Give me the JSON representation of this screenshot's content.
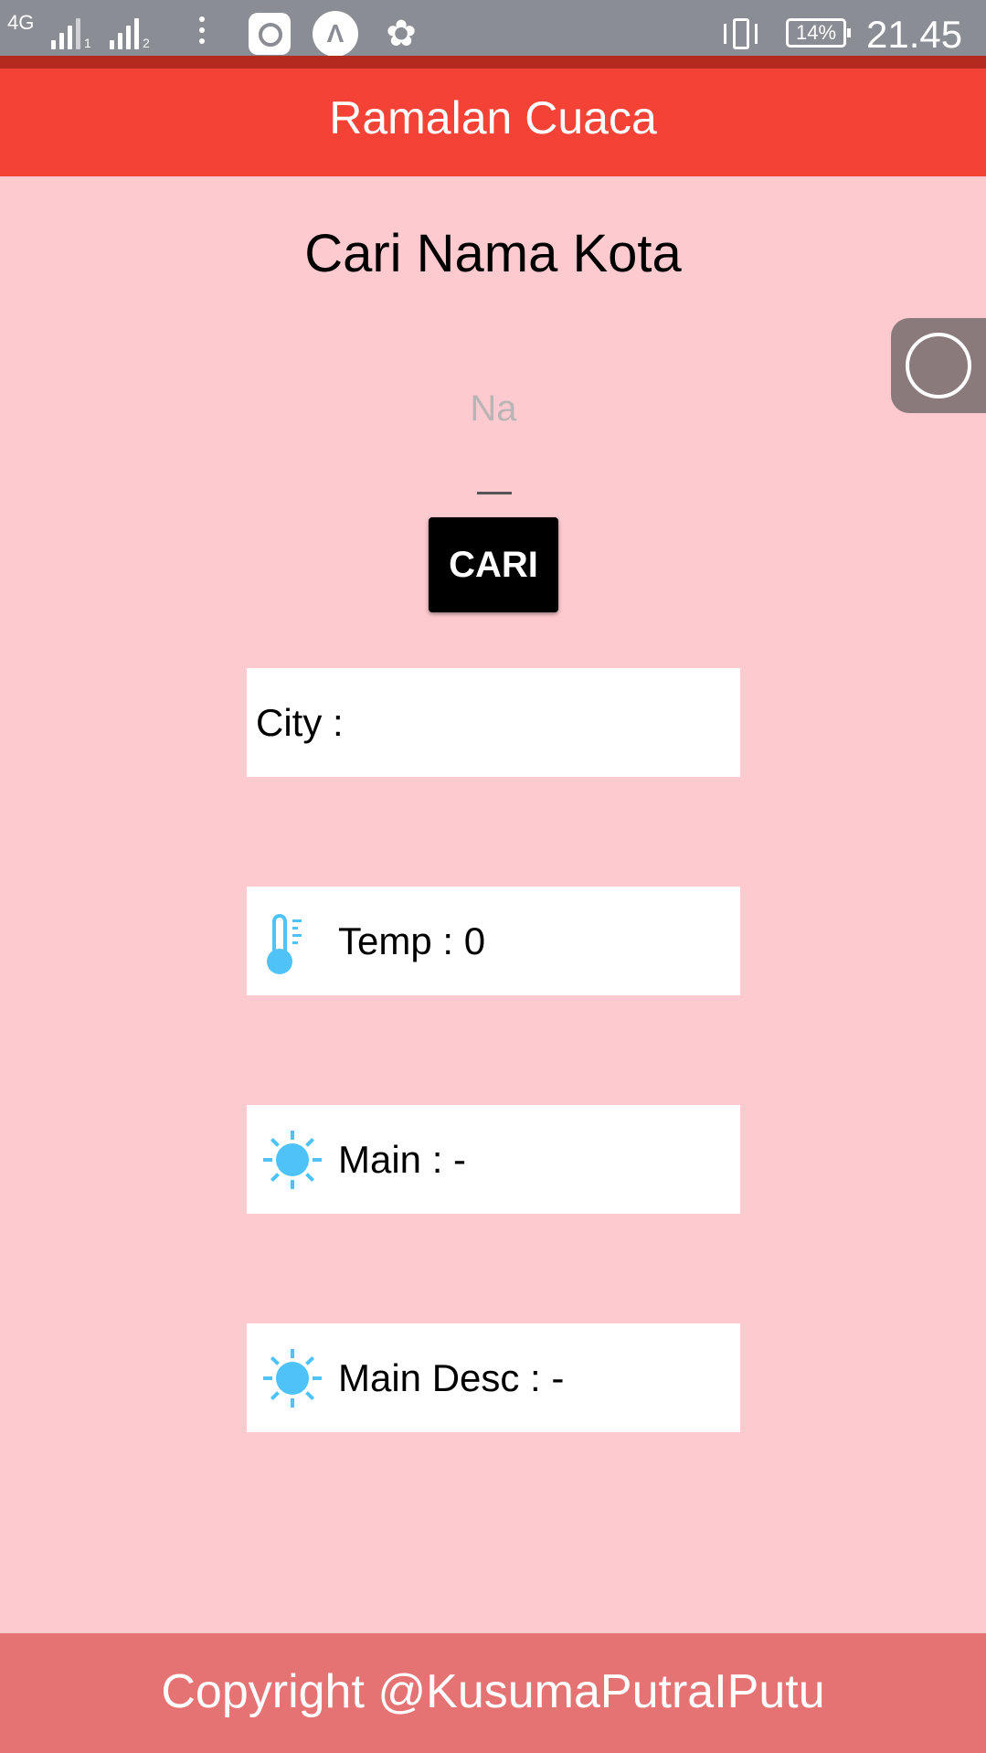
{
  "status_bar": {
    "network": "4G",
    "sim1": "1",
    "sim2": "2",
    "battery": "14%",
    "time": "21.45"
  },
  "app_bar": {
    "title": "Ramalan Cuaca"
  },
  "main": {
    "heading": "Cari Nama Kota",
    "search": {
      "placeholder": "Na",
      "value": ""
    },
    "search_button": "CARI",
    "cards": {
      "city": "City :",
      "temp": "Temp : 0",
      "main": "Main : -",
      "desc": "Main Desc : -"
    },
    "icons": {
      "temp": "thermometer-icon",
      "main": "sun-icon",
      "desc": "sun-icon"
    },
    "icon_color": "#4fc3f7"
  },
  "footer": {
    "text": "Copyright @KusumaPutraIPutu"
  },
  "colors": {
    "app_bar": "#f44336",
    "background": "#fdcacf",
    "footer": "#e57373",
    "button": "#000000"
  }
}
